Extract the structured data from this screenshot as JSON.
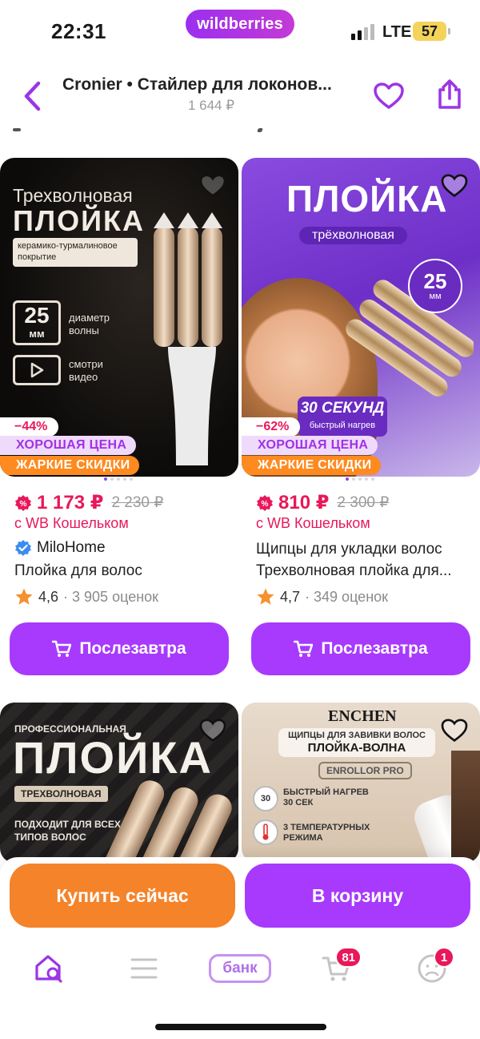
{
  "status_bar": {
    "time": "22:31",
    "brand": "wildberries",
    "network": "LTE",
    "battery": "57"
  },
  "header": {
    "title": "Cronier • Стайлер для локонов...",
    "price": "1 644 ₽"
  },
  "products": [
    {
      "image_text": {
        "line1": "Трехволновая",
        "line2": "ПЛОЙКА",
        "line3": "керамико-турмалиновое покрытие",
        "line4": "25",
        "line5": "мм",
        "line6": "диаметр волны",
        "line7": "смотри видео"
      },
      "discount": "−44%",
      "badge_good": "ХОРОШАЯ ЦЕНА",
      "badge_hot": "ЖАРКИЕ СКИДКИ",
      "price": "1 173 ₽",
      "old_price": "2 230 ₽",
      "wallet_note": "с WB Кошельком",
      "seller": "MiloHome",
      "name": "Плойка для волос",
      "rating": "4,6",
      "reviews": "· 3 905 оценок",
      "button": "Послезавтра"
    },
    {
      "image_text": {
        "line1": "ПЛОЙКА",
        "line2": "трёхволновая",
        "line3": "30 СЕКУНД",
        "line4": "быстрый нагрев",
        "line5": "25",
        "line6": "мм"
      },
      "discount": "−62%",
      "badge_good": "ХОРОШАЯ ЦЕНА",
      "badge_hot": "ЖАРКИЕ СКИДКИ",
      "price": "810 ₽",
      "old_price": "2 300 ₽",
      "wallet_note": "с WB Кошельком",
      "name_line1": "Щипцы для укладки волос",
      "name_line2": "Трехволновая плойка для...",
      "rating": "4,7",
      "reviews": "· 349 оценок",
      "button": "Послезавтра"
    },
    {
      "image_text": {
        "line1": "ПРОФЕССИОНАЛЬНАЯ",
        "line2": "ПЛОЙКА",
        "line3": "ТРЕХВОЛНОВАЯ",
        "line4": "ПОДХОДИТ ДЛЯ ВСЕХ ТИПОВ ВОЛОС"
      }
    },
    {
      "image_text": {
        "line1": "ENCHEN",
        "line2": "ЩИПЦЫ ДЛЯ ЗАВИВКИ ВОЛОС",
        "line3": "ПЛОЙКА-ВОЛНА",
        "line4": "ENROLLOR PRO",
        "line5": "БЫСТРЫЙ НАГРЕВ 30 СЕК",
        "line6": "3 ТЕМПЕРАТУРНЫХ РЕЖИМА",
        "line7": "30"
      }
    }
  ],
  "actions": {
    "buy_now": "Купить сейчас",
    "to_cart": "В корзину"
  },
  "tab_bar": {
    "bank": "банк",
    "cart_count": "81",
    "profile_count": "1"
  },
  "colors": {
    "accent": "#a73afd",
    "orange": "#f4832a",
    "price_red": "#e8185a"
  }
}
